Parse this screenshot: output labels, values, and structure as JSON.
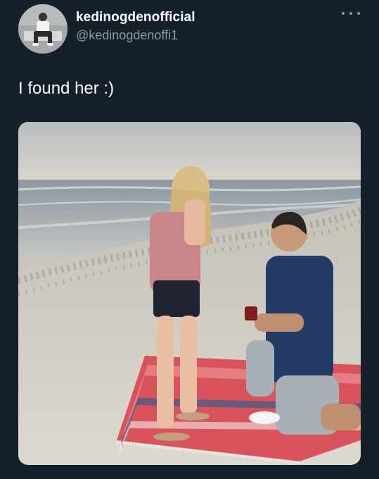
{
  "tweet": {
    "author": {
      "display_name": "kedinogdenofficial",
      "handle": "@kedinogdenoffi1",
      "avatar_icon": "user-avatar"
    },
    "more_icon": "ellipsis-icon",
    "text": "I found her :)",
    "media": {
      "type": "photo",
      "icon": "photo-proposal-beach"
    }
  },
  "colors": {
    "background": "#15202b",
    "primary_text": "#ffffff",
    "secondary_text": "#8899a6"
  }
}
